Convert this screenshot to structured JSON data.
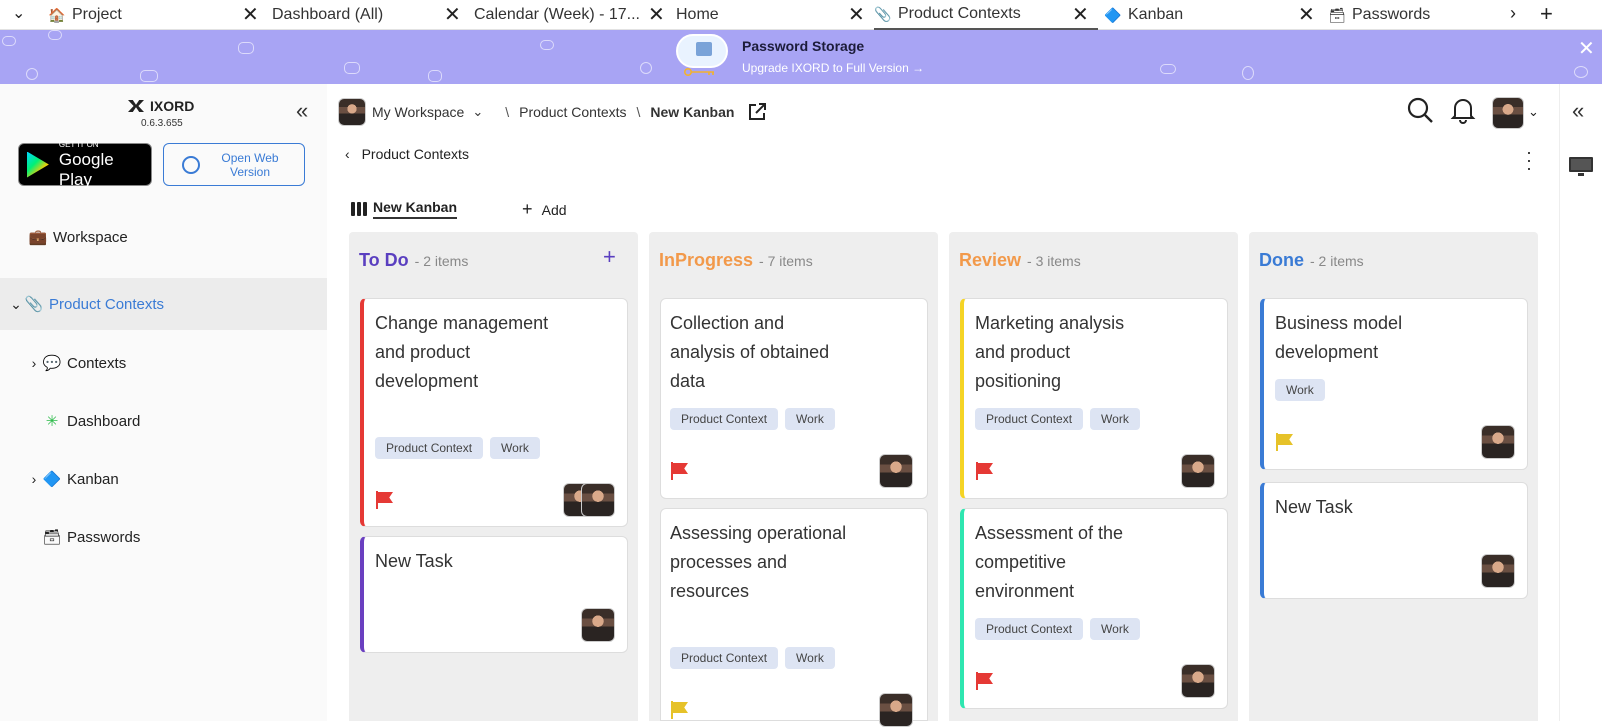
{
  "browser": {
    "tabs": [
      {
        "icon": "🏠",
        "label": "Project"
      },
      {
        "icon": "",
        "label": "Dashboard (All)"
      },
      {
        "icon": "",
        "label": "Calendar (Week) - 17..."
      },
      {
        "icon": "",
        "label": "Home"
      },
      {
        "icon": "📎",
        "label": "Product Contexts"
      },
      {
        "icon": "🔷",
        "label": "Kanban"
      },
      {
        "icon": "🗃",
        "label": "Passwords"
      }
    ]
  },
  "banner": {
    "title": "Password Storage",
    "subtitle": "Upgrade IXORD to Full Version →"
  },
  "sidebar": {
    "app_name": "IXORD",
    "version": "0.6.3.655",
    "gplay_small": "GET IT ON",
    "gplay_big": "Google Play",
    "web_button": "Open Web Version",
    "items": [
      {
        "icon": "💼",
        "label": "Workspace"
      },
      {
        "icon": "📎",
        "label": "Product Contexts"
      },
      {
        "icon": "💬",
        "label": "Contexts"
      },
      {
        "icon": "✳",
        "label": "Dashboard"
      },
      {
        "icon": "🔷",
        "label": "Kanban"
      },
      {
        "icon": "🗃",
        "label": "Passwords"
      }
    ]
  },
  "header": {
    "workspace": "My Workspace",
    "crumb1": "Product Contexts",
    "crumb2": "New Kanban",
    "back": "Product Contexts",
    "view_tab": "New Kanban",
    "add_view": "Add"
  },
  "columns": [
    {
      "title": "To Do",
      "count": "- 2 items",
      "color": "#5a3fc0",
      "cards": [
        {
          "title": "Change management and product development",
          "tags": [
            "Product Context",
            "Work"
          ],
          "accent": "#e53935",
          "flag": "#e53935"
        },
        {
          "title": "New Task",
          "tags": [],
          "accent": "#6a3fc0",
          "flag": ""
        }
      ]
    },
    {
      "title": "InProgress",
      "count": "- 7 items",
      "color": "#f2994a",
      "cards": [
        {
          "title": "Collection and analysis of obtained data",
          "tags": [
            "Product Context",
            "Work"
          ],
          "accent": "#dddddd",
          "flag": "#e53935"
        },
        {
          "title": "Assessing operational processes and resources",
          "tags": [
            "Product Context",
            "Work"
          ],
          "accent": "#dddddd",
          "flag": "#e6c229"
        }
      ]
    },
    {
      "title": "Review",
      "count": "- 3 items",
      "color": "#f2994a",
      "cards": [
        {
          "title": "Marketing analysis and product positioning",
          "tags": [
            "Product Context",
            "Work"
          ],
          "accent": "#f5d425",
          "flag": "#e53935"
        },
        {
          "title": "Assessment of the competitive environment",
          "tags": [
            "Product Context",
            "Work"
          ],
          "accent": "#2ee6b0",
          "flag": "#e53935"
        }
      ]
    },
    {
      "title": "Done",
      "count": "- 2 items",
      "color": "#3a7bd5",
      "cards": [
        {
          "title": "Business model development",
          "tags": [
            "Work"
          ],
          "accent": "#3a7bd5",
          "flag": "#e6c229"
        },
        {
          "title": "New Task",
          "tags": [],
          "accent": "#3a7bd5",
          "flag": ""
        }
      ]
    }
  ]
}
